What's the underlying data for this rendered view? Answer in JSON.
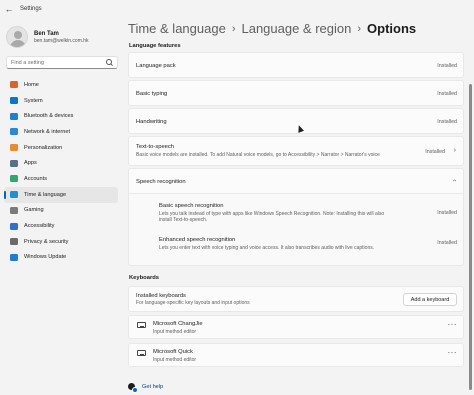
{
  "window": {
    "title": "Settings"
  },
  "profile": {
    "name": "Ben Tam",
    "email": "ben.tam@welkin.com.hk"
  },
  "search": {
    "placeholder": "Find a setting"
  },
  "nav": [
    {
      "label": "Home",
      "icon": "home-icon",
      "color": "#e0622b"
    },
    {
      "label": "System",
      "icon": "system-icon",
      "color": "#0078d4"
    },
    {
      "label": "Bluetooth & devices",
      "icon": "bluetooth-icon",
      "color": "#1a7fd9"
    },
    {
      "label": "Network & internet",
      "icon": "network-icon",
      "color": "#2b88d8"
    },
    {
      "label": "Personalization",
      "icon": "brush-icon",
      "color": "#e98a2f"
    },
    {
      "label": "Apps",
      "icon": "apps-icon",
      "color": "#5c6f8a"
    },
    {
      "label": "Accounts",
      "icon": "accounts-icon",
      "color": "#2ea96a"
    },
    {
      "label": "Time & language",
      "icon": "globe-clock-icon",
      "color": "#1f8fd6",
      "active": true
    },
    {
      "label": "Gaming",
      "icon": "gaming-icon",
      "color": "#7b7b7b"
    },
    {
      "label": "Accessibility",
      "icon": "accessibility-icon",
      "color": "#2f6fd1"
    },
    {
      "label": "Privacy & security",
      "icon": "shield-icon",
      "color": "#6b6b6b"
    },
    {
      "label": "Windows Update",
      "icon": "windows-update-icon",
      "color": "#1e7bd6"
    }
  ],
  "header": {
    "crumb1": "Time & language",
    "crumb2": "Language & region",
    "current": "Options",
    "separator": "›"
  },
  "language_features": {
    "title": "Language features",
    "language_pack": {
      "label": "Language pack",
      "status": "Installed"
    },
    "basic_typing": {
      "label": "Basic typing",
      "status": "Installed"
    },
    "handwriting": {
      "label": "Handwriting",
      "status": "Installed"
    },
    "tts": {
      "label": "Text-to-speech",
      "desc": "Basic voice models are installed. To add Natural voice models, go to Accessibility > Narrator > Narrator's voice",
      "status": "Installed"
    },
    "speech": {
      "label": "Speech recognition",
      "basic": {
        "label": "Basic speech recognition",
        "desc_line1": "Lets you talk instead of type with apps like Windows Speech Recognition. Note: Installing this will also",
        "desc_line2": "install Text-to-speech.",
        "status": "Installed"
      },
      "enhanced": {
        "label": "Enhanced speech recognition",
        "desc": "Lets you enter text with voice typing and voice access. It also transcribes audio with live captions.",
        "status": "Installed"
      }
    }
  },
  "keyboards": {
    "title": "Keyboards",
    "installed": {
      "label": "Installed keyboards",
      "desc": "For language-specific key layouts and input options",
      "button": "Add a keyboard"
    },
    "items": [
      {
        "name": "Microsoft ChangJie",
        "type": "Input method editor"
      },
      {
        "name": "Microsoft Quick",
        "type": "Input method editor"
      }
    ]
  },
  "help": {
    "label": "Get help"
  },
  "colors": {
    "accent": "#0067c0",
    "link": "#003e92"
  }
}
